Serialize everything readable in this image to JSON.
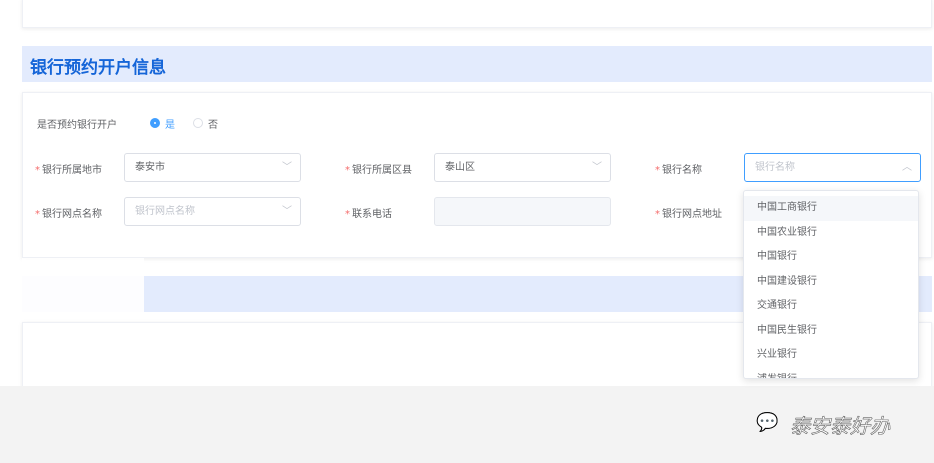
{
  "section_title": "银行预约开户信息",
  "form": {
    "reserve_label": "是否预约银行开户",
    "reserve_yes": "是",
    "reserve_no": "否",
    "reserve_selected": "是",
    "city_label": "银行所属地市",
    "city_value": "泰安市",
    "district_label": "银行所属区县",
    "district_value": "泰山区",
    "bank_label": "银行名称",
    "bank_placeholder": "银行名称",
    "branch_label": "银行网点名称",
    "branch_placeholder": "银行网点名称",
    "phone_label": "联系电话",
    "address_label": "银行网点地址"
  },
  "dropdown": {
    "options": [
      "中国工商银行",
      "中国农业银行",
      "中国银行",
      "中国建设银行",
      "交通银行",
      "中国民生银行",
      "兴业银行",
      "浦发银行"
    ],
    "highlighted": "中国工商银行"
  },
  "watermark": "泰安泰好办",
  "colors": {
    "accent": "#409eff",
    "title": "#1565d8",
    "band": "#e3ebfd"
  }
}
